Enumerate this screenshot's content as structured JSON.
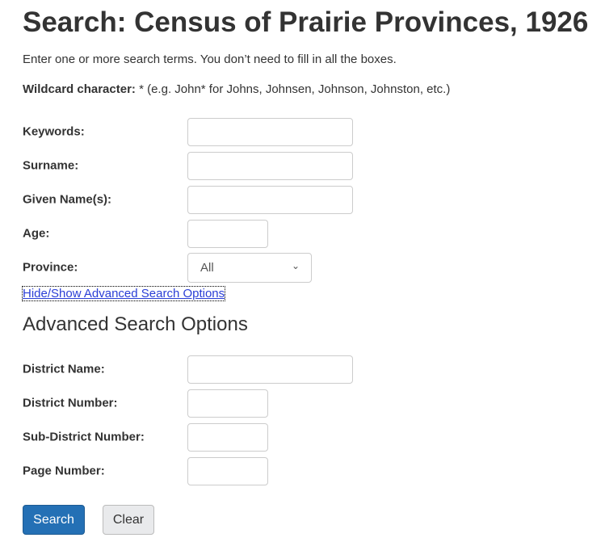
{
  "title": "Search: Census of Prairie Provinces, 1926",
  "intro": "Enter one or more search terms. You don’t need to fill in all the boxes.",
  "wildcard_label": "Wildcard character:",
  "wildcard_text": " * (e.g. John* for Johns, Johnsen, Johnson, Johnston, etc.)",
  "fields": {
    "keywords": {
      "label": "Keywords:",
      "value": ""
    },
    "surname": {
      "label": "Surname:",
      "value": ""
    },
    "given": {
      "label": "Given Name(s):",
      "value": ""
    },
    "age": {
      "label": "Age:",
      "value": ""
    },
    "province": {
      "label": "Province:",
      "value": "All"
    }
  },
  "toggle_link": "Hide/Show Advanced Search Options",
  "advanced": {
    "heading": "Advanced Search Options",
    "district_name": "District Name:",
    "district_number": "District Number:",
    "sub_district": "Sub-District Number:",
    "page_number": "Page Number:"
  },
  "buttons": {
    "search": "Search",
    "clear": "Clear"
  },
  "colors": {
    "primary": "#2470b5",
    "link": "#2a3ed6"
  }
}
